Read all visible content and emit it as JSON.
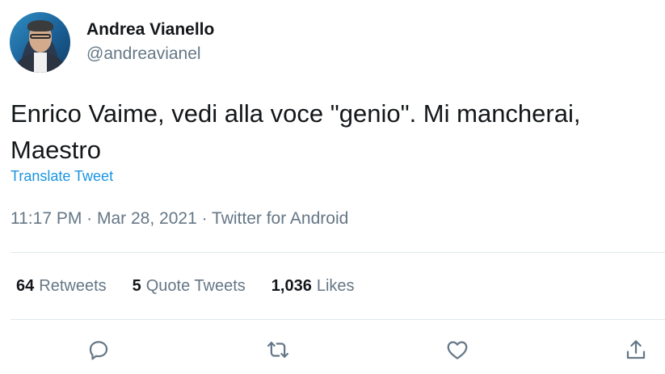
{
  "user": {
    "display_name": "Andrea Vianello",
    "handle": "@andreavianel"
  },
  "tweet": {
    "text": "Enrico Vaime, vedi alla voce \"genio\". Mi mancherai, Maestro",
    "translate_label": "Translate Tweet",
    "time": "11:17 PM",
    "separator1": " · ",
    "date": "Mar 28, 2021",
    "separator2": " · ",
    "source": "Twitter for Android"
  },
  "stats": {
    "retweets_count": "64",
    "retweets_label": "Retweets",
    "quotes_count": "5",
    "quotes_label": "Quote Tweets",
    "likes_count": "1,036",
    "likes_label": "Likes"
  },
  "actions": {
    "reply_icon": "reply-icon",
    "retweet_icon": "retweet-icon",
    "like_icon": "heart-icon",
    "share_icon": "share-icon"
  },
  "colors": {
    "text_primary": "#14171a",
    "text_secondary": "#657786",
    "link": "#1b95e0",
    "divider": "#e1e8ed"
  }
}
